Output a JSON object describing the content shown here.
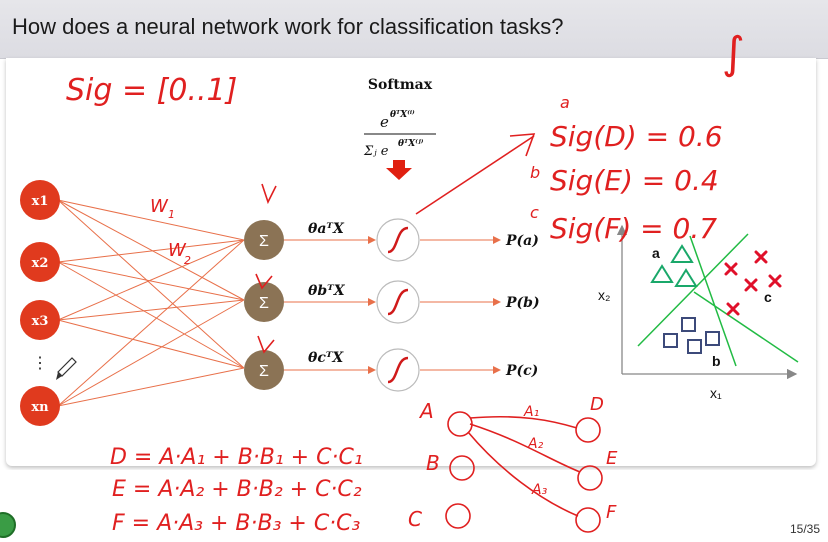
{
  "slide": {
    "title": "How does a neural network work for classification tasks?",
    "page": "15/35"
  },
  "network": {
    "inputs": [
      "x1",
      "x2",
      "x3",
      "⋮",
      "xn"
    ],
    "sum_symbol": "Σ",
    "weight_labels": [
      "W",
      "1",
      "W",
      "2"
    ],
    "softmax_label": "Softmax",
    "softmax_numerator": "e",
    "softmax_num_sup": "θᵀX⁽ⁱ⁾",
    "softmax_denominator": "Σⱼ e",
    "softmax_den_sup": "θᵀX⁽ʲ⁾",
    "products": [
      "θaᵀX",
      "θbᵀX",
      "θcᵀX"
    ],
    "outputs": [
      "P(a)",
      "P(b)",
      "P(c)"
    ]
  },
  "plot": {
    "ylabel": "x₂",
    "xlabel": "x₁",
    "class_a": "a",
    "class_b": "b",
    "class_c": "c"
  },
  "handwriting": {
    "sig_range": "Sig = [0..1]",
    "sig_d": "Sig(D) = 0.6",
    "sig_e": "Sig(E) = 0.4",
    "sig_f": "Sig(F) = 0.7",
    "letter_a": "a",
    "letter_b": "b",
    "letter_c": "c",
    "integral": "∫",
    "node_a": "A",
    "node_b": "B",
    "node_c": "C",
    "node_d": "D",
    "node_e": "E",
    "node_f": "F",
    "edge_a1": "A₁",
    "edge_a2": "A₂",
    "edge_a3": "A₃",
    "eq_d": "D = A·A₁ + B·B₁ + C·C₁",
    "eq_e": "E = A·A₂ + B·B₂ + C·C₂",
    "eq_f": "F = A·A₃ + B·B₃ + C·C₃"
  },
  "colors": {
    "input_node": "#e03a1e",
    "sum_node": "#8b7355",
    "edge": "#e8704a",
    "ink": "#e02020",
    "triangle": "#1aa86a",
    "cross": "#e0102a",
    "square": "#3c4a7a",
    "boundary": "#22bb44"
  }
}
